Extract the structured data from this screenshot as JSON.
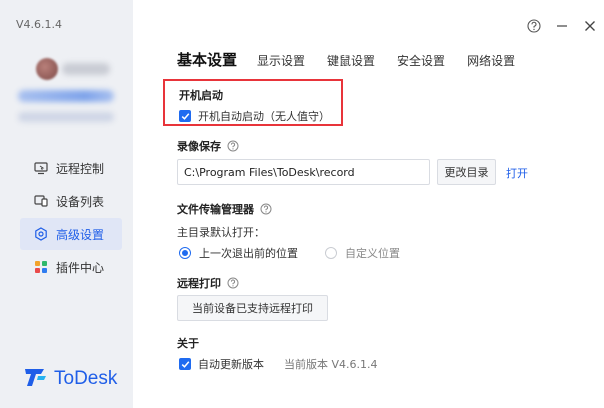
{
  "app": {
    "version": "V4.6.1.4",
    "brand_name": "ToDesk",
    "accent_color": "#1f5ee8"
  },
  "sidebar": {
    "items": [
      {
        "label": "远程控制",
        "icon": "remote-control-icon",
        "active": false
      },
      {
        "label": "设备列表",
        "icon": "device-list-icon",
        "active": false
      },
      {
        "label": "高级设置",
        "icon": "advanced-settings-icon",
        "active": true
      },
      {
        "label": "插件中心",
        "icon": "plugin-center-icon",
        "active": false
      }
    ]
  },
  "tabs": [
    {
      "label": "基本设置",
      "active": true
    },
    {
      "label": "显示设置",
      "active": false
    },
    {
      "label": "键鼠设置",
      "active": false
    },
    {
      "label": "安全设置",
      "active": false
    },
    {
      "label": "网络设置",
      "active": false
    }
  ],
  "startup": {
    "title": "开机启动",
    "checkbox_label": "开机自动启动（无人值守）",
    "checked": true
  },
  "recording": {
    "title": "录像保存",
    "path": "C:\\Program Files\\ToDesk\\record",
    "change_dir_label": "更改目录",
    "open_label": "打开"
  },
  "file_transfer": {
    "title": "文件传输管理器",
    "default_dir_label": "主目录默认打开：",
    "options": [
      {
        "label": "上一次退出前的位置",
        "selected": true
      },
      {
        "label": "自定义位置",
        "selected": false
      }
    ]
  },
  "remote_print": {
    "title": "远程打印",
    "button_label": "当前设备已支持远程打印"
  },
  "about": {
    "title": "关于",
    "auto_update_label": "自动更新版本",
    "auto_update_checked": true,
    "current_version_label": "当前版本 V4.6.1.4"
  }
}
